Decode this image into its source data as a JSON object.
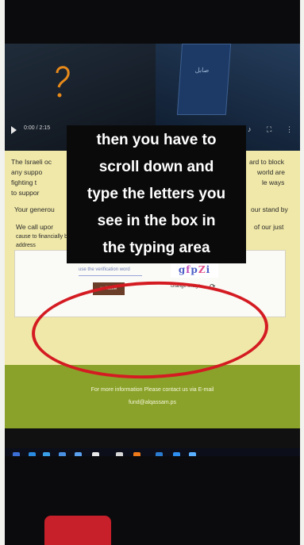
{
  "caption": {
    "lines": [
      "then you have to",
      "scroll down and",
      "type the letters you",
      "see in the box in",
      "the typing area"
    ]
  },
  "video": {
    "time": "0:00 / 2:15",
    "phone_text": "صابل",
    "glyph": "orange-curve",
    "icons": [
      "play-icon",
      "volume-icon",
      "fullscreen-icon",
      "more-icon"
    ]
  },
  "page": {
    "intro_left": "The Israeli oc",
    "intro_right": "ard to block",
    "line2_left": "any suppo",
    "line2_right": "world are",
    "line3_left": "fighting t",
    "line3_right": "le ways",
    "line4_left": "to suppor",
    "line5_left": "Your generou",
    "line5_right": "our stand by",
    "line6_left": "We call upor",
    "line6_right": "of our just",
    "line7": "cause to financially back the resistance. Be present on the following wallet",
    "line8": "address"
  },
  "captcha": {
    "input_placeholder": "use the verification word",
    "validate_label": "validate",
    "image_text": [
      "g",
      "f",
      "p",
      "Z",
      "i"
    ],
    "change_image_label": "change image",
    "refresh_icon": "refresh-icon"
  },
  "footer": {
    "contact": "For more information Please contact us via E-mail",
    "email": "fund@alqassam.ps"
  },
  "colors": {
    "page_background": "#f0e8a8",
    "footer": "#8aa22a",
    "circle": "#d41b22",
    "validate_button": "#6b3e2a"
  }
}
